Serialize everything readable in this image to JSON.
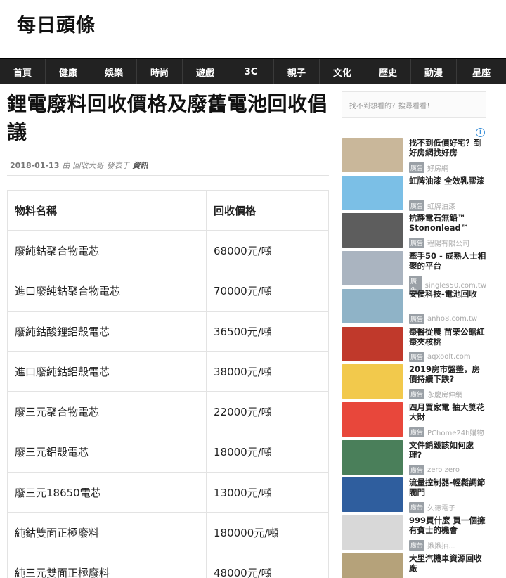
{
  "site": {
    "title": "每日頭條"
  },
  "nav": [
    "首頁",
    "健康",
    "娛樂",
    "時尚",
    "遊戲",
    "3C",
    "親子",
    "文化",
    "歷史",
    "動漫",
    "星座"
  ],
  "article": {
    "title": "鋰電廢料回收價格及廢舊電池回收倡議",
    "date": "2018-01-13",
    "by": "由",
    "author": "回收大哥",
    "published_in": "發表于",
    "category": "資訊"
  },
  "table": {
    "headers": [
      "物料名稱",
      "回收價格"
    ],
    "rows": [
      [
        "廢純鈷聚合物電芯",
        "68000元/噸"
      ],
      [
        "進口廢純鈷聚合物電芯",
        "70000元/噸"
      ],
      [
        "廢純鈷酸鋰鋁殼電芯",
        "36500元/噸"
      ],
      [
        "進口廢純鈷鋁殼電芯",
        "38000元/噸"
      ],
      [
        "廢三元聚合物電芯",
        "22000元/噸"
      ],
      [
        "廢三元鋁殼電芯",
        "18000元/噸"
      ],
      [
        "廢三元18650電芯",
        "13000元/噸"
      ],
      [
        "純鈷雙面正極廢料",
        "180000元/噸"
      ],
      [
        "純三元雙面正極廢料",
        "48000元/噸"
      ]
    ]
  },
  "search": {
    "placeholder": "找不到想看的？搜尋看看！"
  },
  "ads": {
    "info_icon": "info-icon",
    "badge": "廣告",
    "items": [
      {
        "title": "找不到低價好宅？到好房網找好房",
        "source": "好房網",
        "color": "#c9b79a"
      },
      {
        "title": "虹牌油漆 全效乳膠漆",
        "source": "虹牌油漆",
        "color": "#7bbfe6"
      },
      {
        "title": "抗靜電石無鉛™ Stononlead™",
        "source": "程陽有限公司",
        "color": "#5d5d5d"
      },
      {
        "title": "牽手50 - 成熟人士相聚的平台",
        "source": "singles50.com.tw",
        "color": "#aab4c0"
      },
      {
        "title": "安侯科技-電池回收",
        "source": "anho8.com.tw",
        "color": "#8fb3c7"
      },
      {
        "title": "棗醫從農 苗栗公館紅棗夾核桃",
        "source": "aqxoolt.com",
        "color": "#c0392b"
      },
      {
        "title": "2019房市盤整，房價持續下跌?",
        "source": "永慶房仲網",
        "color": "#f2c94c"
      },
      {
        "title": "四月買家電 抽大獎花大財",
        "source": "PChome24h購物",
        "color": "#e8473b"
      },
      {
        "title": "文件銷毀該如何處理?",
        "source": "zero zero",
        "color": "#4a7f5a"
      },
      {
        "title": "流量控制器-輕鬆調節閥門",
        "source": "久德電子",
        "color": "#2f5e9e"
      },
      {
        "title": "999買什麼 買一個擁有賓士的機會",
        "source": "揪揪抽...",
        "color": "#d8d8d8"
      },
      {
        "title": "大里汽機車資源回收廠",
        "source": "",
        "color": "#b5a27a"
      }
    ]
  }
}
